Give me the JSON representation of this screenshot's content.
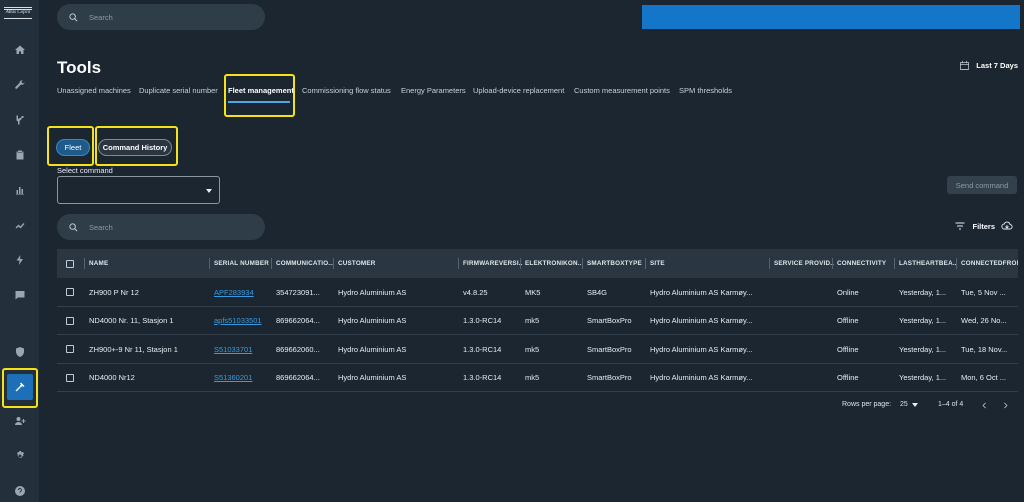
{
  "logo": {
    "text": "Atlas Copco"
  },
  "search": {
    "placeholder": "Search"
  },
  "page": {
    "title": "Tools",
    "date_range": "Last 7 Days"
  },
  "sidebar": {
    "items": [
      {
        "icon": "home-icon"
      },
      {
        "icon": "wrench-icon"
      },
      {
        "icon": "machine-icon"
      },
      {
        "icon": "clipboard-icon"
      },
      {
        "icon": "bar-chart-icon"
      },
      {
        "icon": "trend-icon"
      },
      {
        "icon": "bolt-icon"
      },
      {
        "icon": "chat-icon"
      },
      {
        "icon": "shield-icon"
      },
      {
        "icon": "tools-icon",
        "active": true
      },
      {
        "icon": "add-user-icon"
      },
      {
        "icon": "gear-icon"
      },
      {
        "icon": "help-icon"
      }
    ]
  },
  "tabs": [
    {
      "label": "Unassigned machines"
    },
    {
      "label": "Duplicate serial number"
    },
    {
      "label": "Fleet management",
      "active": true
    },
    {
      "label": "Commissioning flow status"
    },
    {
      "label": "Energy Parameters"
    },
    {
      "label": "Upload-device replacement"
    },
    {
      "label": "Custom measurement points"
    },
    {
      "label": "SPM thresholds"
    }
  ],
  "subtabs": {
    "fleet": "Fleet",
    "history": "Command History"
  },
  "command": {
    "label": "Select command",
    "value": "",
    "send_label": "Send command"
  },
  "table_search": {
    "placeholder": "Search"
  },
  "filters": {
    "label": "Filters"
  },
  "table": {
    "columns": [
      "NAME",
      "SERIAL NUMBER",
      "COMMUNICATIO...",
      "CUSTOMER",
      "FIRMWAREVERSI...",
      "ELEKTRONIKON...",
      "SMARTBOXTYPE",
      "SITE",
      "SERVICE PROVID...",
      "CONNECTIVITY",
      "LASTHEARTBEA...",
      "CONNECTEDFROM"
    ],
    "rows": [
      [
        "ZH900 P Nr 12",
        "APF283934",
        "354723091...",
        "Hydro Aluminium AS",
        "v4.8.25",
        "MK5",
        "SB4G",
        "Hydro Aluminium AS Karmøy...",
        "",
        "Online",
        "Yesterday, 1...",
        "Tue, 5 Nov ..."
      ],
      [
        "ND4000 Nr. 11, Stasjon 1",
        "apfs51033501",
        "869662064...",
        "Hydro Aluminium AS",
        "1.3.0-RC14",
        "mk5",
        "SmartBoxPro",
        "Hydro Aluminium AS Karmøy...",
        "",
        "Offline",
        "Yesterday, 1...",
        "Wed, 26 No..."
      ],
      [
        "ZH900+-9 Nr 11, Stasjon 1",
        "S51033701",
        "869662060...",
        "Hydro Aluminium AS",
        "1.3.0-RC14",
        "mk5",
        "SmartBoxPro",
        "Hydro Aluminium AS Karmøy...",
        "",
        "Offline",
        "Yesterday, 1...",
        "Tue, 18 Nov..."
      ],
      [
        "ND4000 Nr12",
        "S51360201",
        "869662064...",
        "Hydro Aluminium AS",
        "1.3.0-RC14",
        "mk5",
        "SmartBoxPro",
        "Hydro Aluminium AS Karmøy...",
        "",
        "Offline",
        "Yesterday, 1...",
        "Mon, 6 Oct ..."
      ]
    ]
  },
  "pagination": {
    "rows_label": "Rows per page:",
    "rows_value": "25",
    "range": "1–4 of 4"
  },
  "colors": {
    "accent": "#1d6fb8",
    "link": "#3a9ae0",
    "highlight": "#f4e21a",
    "background": "#1b2630"
  }
}
